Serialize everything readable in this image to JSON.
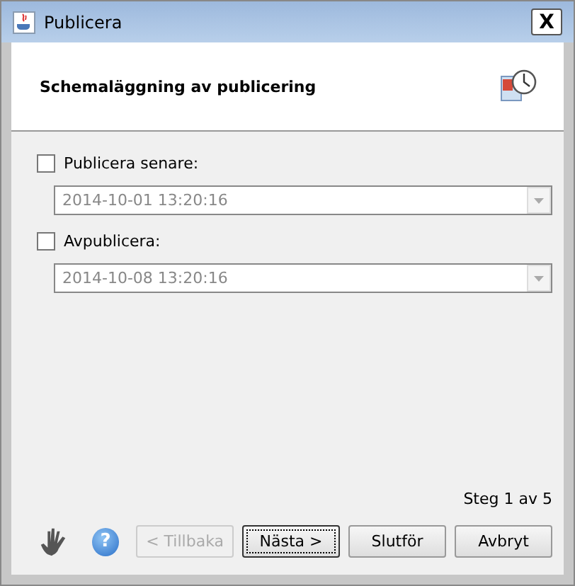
{
  "window": {
    "title": "Publicera",
    "close": "X"
  },
  "header": {
    "title": "Schemaläggning av publicering"
  },
  "options": [
    {
      "label": "Publicera senare:",
      "checked": false,
      "date": {
        "value": "2014-10-01 13:20:16",
        "disabled": true
      }
    },
    {
      "label": "Avpublicera:",
      "checked": false,
      "date": {
        "value": "2014-10-08 13:20:16",
        "disabled": true
      }
    }
  ],
  "step": "Steg 1 av 5",
  "help": "?",
  "buttons": [
    {
      "label": "< Tillbaka",
      "disabled": true,
      "focused": false
    },
    {
      "label": "Nästa >",
      "disabled": false,
      "focused": true
    },
    {
      "label": "Slutför",
      "disabled": false,
      "focused": false
    },
    {
      "label": "Avbryt",
      "disabled": false,
      "focused": false
    }
  ]
}
